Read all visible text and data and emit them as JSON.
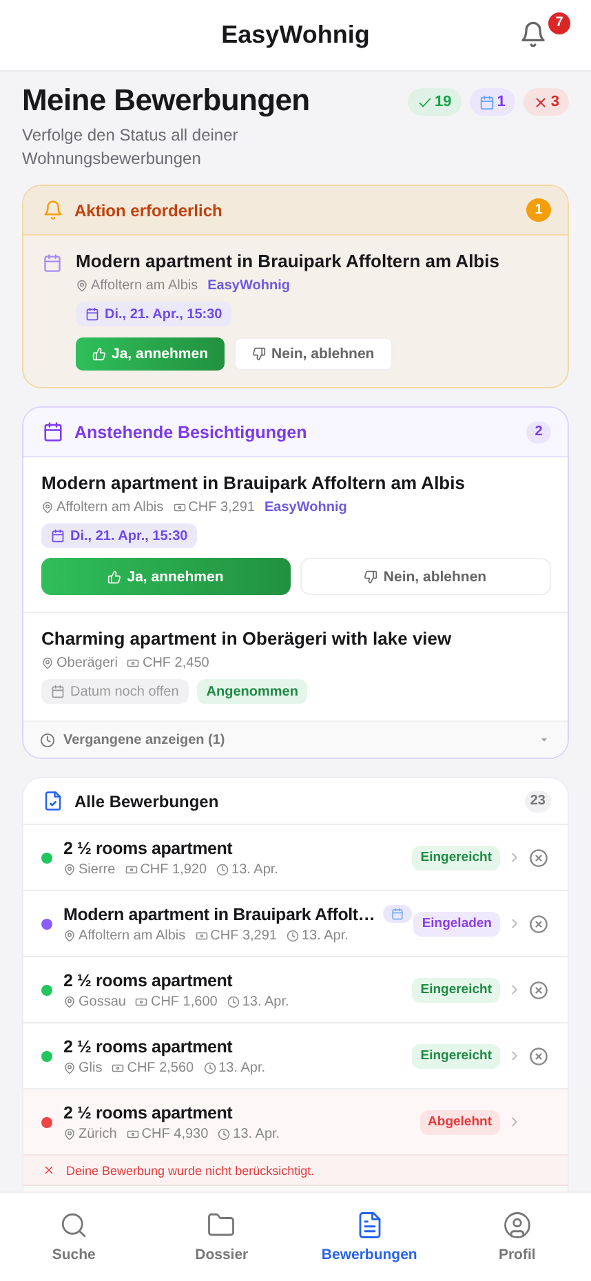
{
  "header": {
    "title": "EasyWohnig",
    "notification_count": "7"
  },
  "page": {
    "title": "Meine Bewerbungen",
    "subtitle": "Verfolge den Status all deiner Wohnungsbewerbungen",
    "summary": [
      {
        "kind": "accepted",
        "count": "19"
      },
      {
        "kind": "invited",
        "count": "1"
      },
      {
        "kind": "rejected",
        "count": "3"
      }
    ]
  },
  "action": {
    "title": "Aktion erforderlich",
    "count": "1",
    "items": [
      {
        "title": "Modern apartment in Brauipark Affoltern am Albis",
        "location": "Affoltern am Albis",
        "agency": "EasyWohnig",
        "date": "Di., 21. Apr., 15:30",
        "accept": "Ja, annehmen",
        "decline": "Nein, ablehnen"
      }
    ]
  },
  "viewings": {
    "title": "Anstehende Besichtigungen",
    "count": "2",
    "items": [
      {
        "title": "Modern apartment in Brauipark Affoltern am Albis",
        "location": "Affoltern am Albis",
        "price": "CHF 3,291",
        "agency": "EasyWohnig",
        "date": "Di., 21. Apr., 15:30",
        "kind": "scheduled",
        "accept": "Ja, annehmen",
        "decline": "Nein, ablehnen"
      },
      {
        "title": "Charming apartment in Oberägeri with lake view",
        "location": "Oberägeri",
        "price": "CHF 2,450",
        "date": "Datum noch offen",
        "kind": "open",
        "status": "Angenommen"
      }
    ],
    "past_toggle": {
      "label": "Vergangene anzeigen (1)",
      "expanded": false
    }
  },
  "applications": {
    "title": "Alle Bewerbungen",
    "count": "23",
    "rows": [
      {
        "title": "2 ½ rooms apartment",
        "location": "Sierre",
        "price": "CHF 1,920",
        "date": "13. Apr.",
        "status": "Eingereicht",
        "kind": "submitted",
        "color": "#22c55e",
        "viewing_badge": false,
        "withdrawable": true
      },
      {
        "title": "Modern apartment in Brauipark Affolt…",
        "location": "Affoltern am Albis",
        "price": "CHF 3,291",
        "date": "13. Apr.",
        "status": "Eingeladen",
        "kind": "invited",
        "color": "#8b5cf6",
        "viewing_badge": true,
        "withdrawable": true
      },
      {
        "title": "2 ½ rooms apartment",
        "location": "Gossau",
        "price": "CHF 1,600",
        "date": "13. Apr.",
        "status": "Eingereicht",
        "kind": "submitted",
        "color": "#22c55e",
        "viewing_badge": false,
        "withdrawable": true
      },
      {
        "title": "2 ½ rooms apartment",
        "location": "Glis",
        "price": "CHF 2,560",
        "date": "13. Apr.",
        "status": "Eingereicht",
        "kind": "submitted",
        "color": "#22c55e",
        "viewing_badge": false,
        "withdrawable": true
      },
      {
        "title": "2 ½ rooms apartment",
        "location": "Zürich",
        "price": "CHF 4,930",
        "date": "13. Apr.",
        "status": "Abgelehnt",
        "kind": "rejected",
        "color": "#ef4444",
        "viewing_badge": false,
        "withdrawable": false,
        "message": "Deine Bewerbung wurde nicht berücksichtigt."
      }
    ]
  },
  "nav": [
    {
      "kind": "search",
      "label": "Suche",
      "selected": false
    },
    {
      "kind": "folder",
      "label": "Dossier",
      "selected": false
    },
    {
      "kind": "document",
      "label": "Bewerbungen",
      "selected": true
    },
    {
      "kind": "profile",
      "label": "Profil",
      "selected": false
    }
  ]
}
